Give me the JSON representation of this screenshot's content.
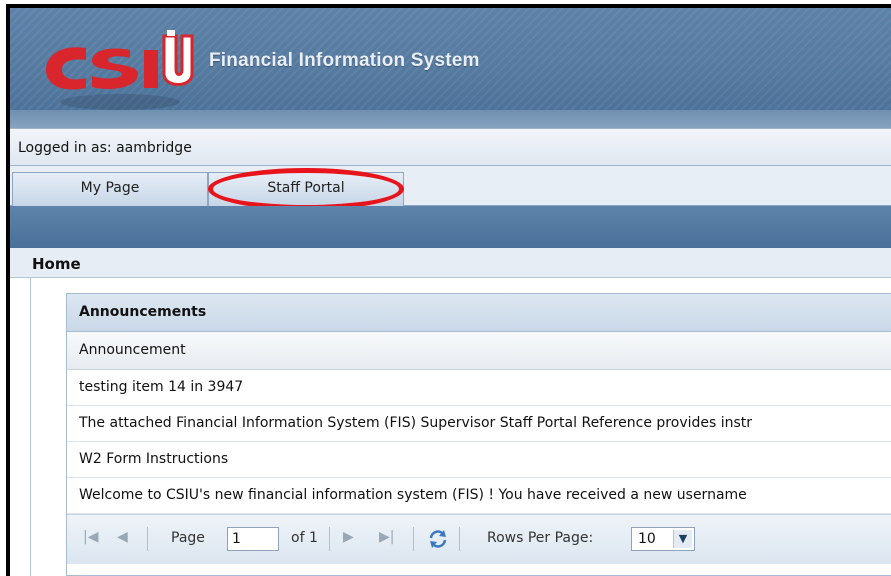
{
  "header": {
    "logo_text": "CSIU",
    "app_title": "Financial Information System"
  },
  "user": {
    "logged_in_text": "Logged in as: aambridge"
  },
  "tabs": [
    {
      "label": "My Page"
    },
    {
      "label": "Staff Portal"
    }
  ],
  "page": {
    "title": "Home"
  },
  "announcements": {
    "title": "Announcements",
    "column_header": "Announcement",
    "rows": [
      "testing item 14 in 3947",
      "The attached Financial Information System (FIS) Supervisor Staff Portal Reference provides instr",
      "W2 Form Instructions",
      "Welcome to CSIU's new financial information system (FIS) ! You have received a new username"
    ]
  },
  "pager": {
    "page_label": "Page",
    "page_value": "1",
    "of_label": "of 1",
    "rows_per_page_label": "Rows Per Page:",
    "rows_per_page_value": "10"
  },
  "colors": {
    "banner_blue": "#4a6f97",
    "highlight_red": "#e8141b",
    "logo_red": "#d8262c"
  }
}
